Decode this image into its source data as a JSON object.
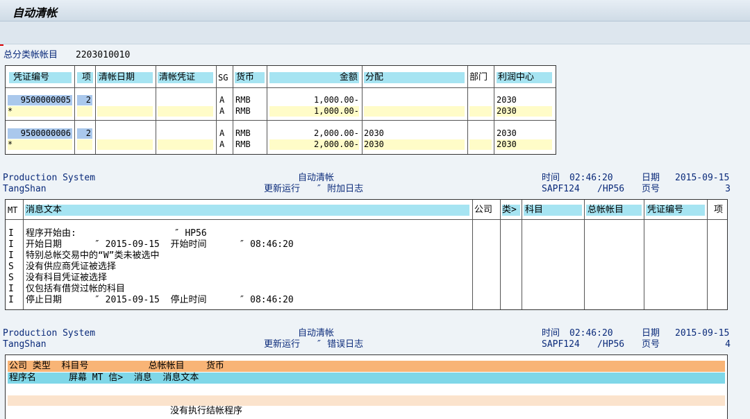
{
  "window": {
    "title": "自动清帐"
  },
  "account": {
    "label": "总分类帐帐目",
    "value": "2203010010"
  },
  "clearing_table": {
    "headers": {
      "doc_no": "凭证编号",
      "item": "项",
      "clear_date": "清帐日期",
      "clear_doc": "清帐凭证",
      "sg": "SG",
      "currency": "货币",
      "amount": "金额",
      "assignment": "分配",
      "dept": "部门",
      "profit_center": "利润中心"
    },
    "groups": [
      {
        "doc_no": "9500000005",
        "item": "2",
        "rows": [
          {
            "star": "",
            "sg": "A",
            "currency": "RMB",
            "amount": "1,000.00-",
            "assignment": "",
            "profit_center": "2030"
          },
          {
            "star": "*",
            "sg": "A",
            "currency": "RMB",
            "amount": "1,000.00-",
            "assignment": "",
            "profit_center": "2030"
          }
        ]
      },
      {
        "doc_no": "9500000006",
        "item": "2",
        "rows": [
          {
            "star": "",
            "sg": "A",
            "currency": "RMB",
            "amount": "2,000.00-",
            "assignment": "2030",
            "profit_center": "2030"
          },
          {
            "star": "*",
            "sg": "A",
            "currency": "RMB",
            "amount": "2,000.00-",
            "assignment": "2030",
            "profit_center": "2030"
          }
        ]
      }
    ]
  },
  "report1": {
    "system": "Production System",
    "site": "TangShan",
    "title": "自动清帐",
    "subtitle": "更新运行   ″ 附加日志",
    "time_label": "时间",
    "time": "02:46:20",
    "program": "SAPF124",
    "user": "/HP56",
    "date_label": "日期",
    "date": "2015-09-15",
    "page_label": "页号",
    "page": "3"
  },
  "log_table": {
    "headers": {
      "mt": "MT",
      "msg": "消息文本",
      "company": "公司",
      "type": "类>",
      "account": "科目",
      "gl": "总帐帐目",
      "doc": "凭证编号",
      "item": "项"
    },
    "rows": [
      {
        "mt": "I",
        "text": "程序开始由:                  ″ HP56"
      },
      {
        "mt": "I",
        "text": "开始日期      ″ 2015-09-15  开始时间      ″ 08:46:20"
      },
      {
        "mt": "I",
        "text": "特别总帐交易中的“W”类未被选中"
      },
      {
        "mt": "S",
        "text": "没有供应商凭证被选择"
      },
      {
        "mt": "S",
        "text": "没有科目凭证被选择"
      },
      {
        "mt": "I",
        "text": "仅包括有借贷过帐的科目"
      },
      {
        "mt": "I",
        "text": "停止日期      ″ 2015-09-15  停止时间      ″ 08:46:20"
      }
    ]
  },
  "report2": {
    "system": "Production System",
    "site": "TangShan",
    "title": "自动清帐",
    "subtitle": "更新运行   ″ 错误日志",
    "time_label": "时间",
    "time": "02:46:20",
    "program": "SAPF124",
    "user": "/HP56",
    "date_label": "日期",
    "date": "2015-09-15",
    "page_label": "页号",
    "page": "4"
  },
  "error_table": {
    "header1": "公司 类型  科目号           总帐帐目    货币",
    "header2": "程序名      屏幕 MT 信>  消息  消息文本",
    "empty_message": "没有执行结帐程序"
  },
  "colors": {
    "header_cyan": "#a6e4f2",
    "input_yellow": "#fffcc8",
    "selected_blue": "#aac8ec",
    "error_orange": "#f8b476"
  }
}
